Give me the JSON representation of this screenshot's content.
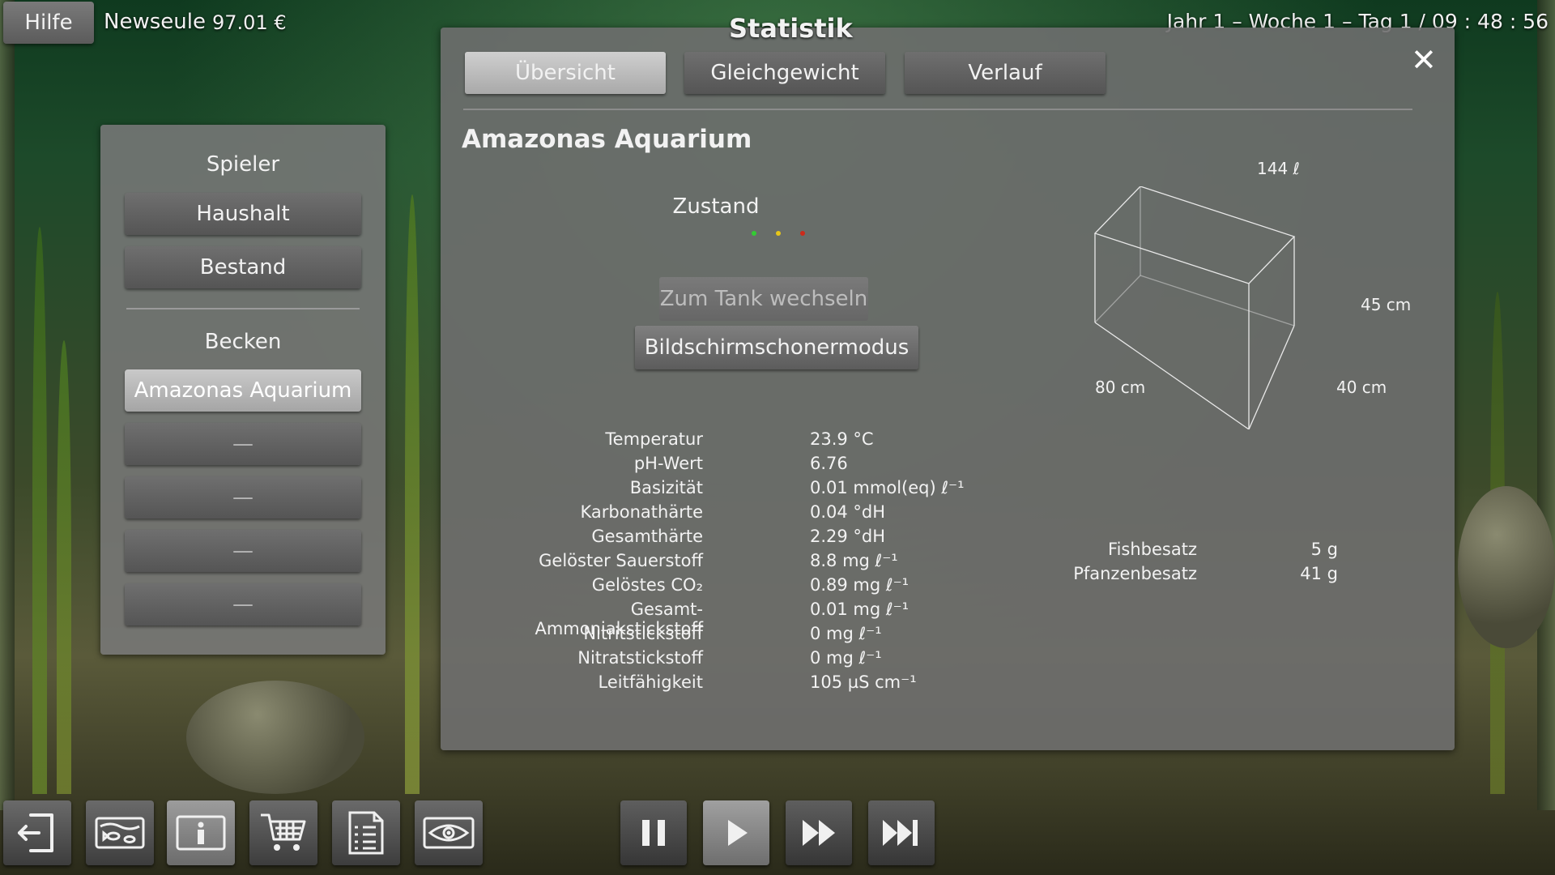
{
  "topbar": {
    "help_label": "Hilfe",
    "player_name": "Newseule",
    "money": "97.01 €",
    "datetime": "Jahr 1 – Woche 1 – Tag 1  /  09 : 48 : 56"
  },
  "left_panel": {
    "player_heading": "Spieler",
    "player_items": [
      "Haushalt",
      "Bestand"
    ],
    "tanks_heading": "Becken",
    "tank_items": [
      "Amazonas Aquarium",
      "—",
      "—",
      "—",
      "—"
    ],
    "selected_tank_index": 0
  },
  "stats": {
    "title": "Statistik",
    "tabs": [
      "Übersicht",
      "Gleichgewicht",
      "Verlauf"
    ],
    "active_tab_index": 0,
    "tank_name": "Amazonas Aquarium",
    "state_label": "Zustand",
    "state_dot_colors": [
      "#33cc33",
      "#e6c619",
      "#cc2a1a"
    ],
    "switch_tank_label": "Zum Tank wechseln",
    "screensaver_label": "Bildschirmschonermodus",
    "tank_volume": "144 ℓ",
    "tank_height": "45 cm",
    "tank_width": "80 cm",
    "tank_depth": "40 cm",
    "parameters": [
      {
        "label": "Temperatur",
        "value": "23.9 °C"
      },
      {
        "label": "pH-Wert",
        "value": "6.76"
      },
      {
        "label": "Basizität",
        "value": "0.01 mmol(eq) ℓ⁻¹"
      },
      {
        "label": "Karbonathärte",
        "value": "0.04 °dH"
      },
      {
        "label": "Gesamthärte",
        "value": "2.29 °dH"
      },
      {
        "label": "Gelöster Sauerstoff",
        "value": "8.8 mg ℓ⁻¹"
      },
      {
        "label": "Gelöstes CO₂",
        "value": "0.89 mg ℓ⁻¹"
      },
      {
        "label": "Gesamt-Ammoniakstickstoff",
        "value": "0.01 mg ℓ⁻¹"
      },
      {
        "label": "Nitritstickstoff",
        "value": "0 mg ℓ⁻¹"
      },
      {
        "label": "Nitratstickstoff",
        "value": "0 mg ℓ⁻¹"
      },
      {
        "label": "Leitfähigkeit",
        "value": "105 µS cm⁻¹"
      }
    ],
    "stocking": [
      {
        "label": "Fishbesatz",
        "value": "5 g"
      },
      {
        "label": "Pfanzenbesatz",
        "value": "41 g"
      }
    ]
  },
  "toolbar": {
    "tools": [
      "exit-icon",
      "aquarium-icon",
      "info-icon",
      "shop-cart-icon",
      "checklist-icon",
      "view-eye-icon"
    ],
    "active_tool_index": 2,
    "speed_controls": [
      "pause-icon",
      "play-icon",
      "fast-forward-icon",
      "skip-forward-icon"
    ],
    "active_speed_index": 1
  }
}
